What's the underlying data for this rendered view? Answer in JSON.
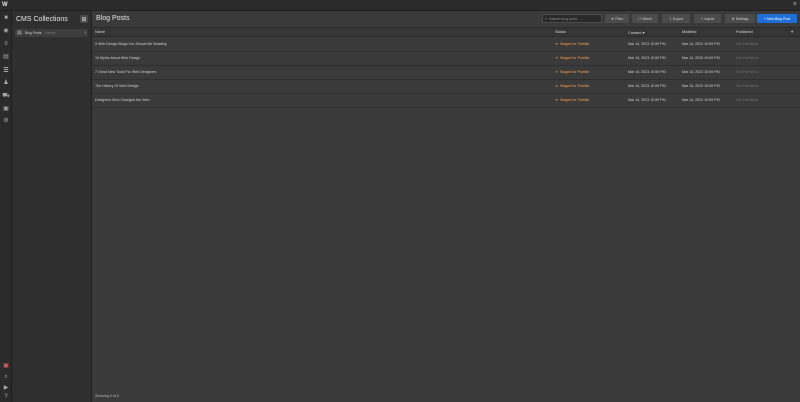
{
  "app": {
    "logo": "W",
    "close_glyph": "×"
  },
  "rail": {
    "icons": [
      "add-icon",
      "pages-icon",
      "navigator-icon",
      "file-icon",
      "cms-icon",
      "users-icon",
      "ecommerce-icon",
      "assets-icon",
      "settings-icon"
    ],
    "bottom_icons": [
      "record-icon",
      "search-icon",
      "video-icon",
      "help-icon"
    ]
  },
  "collections": {
    "title": "CMS Collections",
    "add_glyph": "⊞",
    "items": [
      {
        "label": "Blog Posts",
        "count": "5 items",
        "arrow": "›"
      }
    ]
  },
  "main": {
    "title": "Blog Posts",
    "search_placeholder": "Search blog posts",
    "toolbar": {
      "filter": "▼ Filter",
      "select": "☐ Select",
      "export": "⇩ Export",
      "import": "⇧ Import",
      "settings": "⚙ Settings",
      "new": "+ New Blog Post"
    },
    "columns": {
      "name": "Name",
      "status": "Status",
      "created": "Created ▾",
      "modified": "Modified",
      "published": "Published",
      "pin": "⌖"
    },
    "rows": [
      {
        "name": "5 Web Design Blogs You Should Be Reading",
        "status": "Staged for Publish",
        "created": "Mar 14, 2023 10:59 PM",
        "modified": "Mar 14, 2023 10:59 PM",
        "published": "Not Published"
      },
      {
        "name": "10 Myths About Web Design",
        "status": "Staged for Publish",
        "created": "Mar 14, 2023 10:59 PM",
        "modified": "Mar 14, 2023 10:59 PM",
        "published": "Not Published"
      },
      {
        "name": "7 Great New Tools For Web Designers",
        "status": "Staged for Publish",
        "created": "Mar 14, 2023 10:59 PM",
        "modified": "Mar 14, 2023 10:59 PM",
        "published": "Not Published"
      },
      {
        "name": "The History Of Web Design",
        "status": "Staged for Publish",
        "created": "Mar 14, 2023 10:59 PM",
        "modified": "Mar 14, 2023 10:59 PM",
        "published": "Not Published"
      },
      {
        "name": "Designers Who Changed the Web",
        "status": "Staged for Publish",
        "created": "Mar 14, 2023 10:59 PM",
        "modified": "Mar 14, 2023 10:59 PM",
        "published": "Not Published"
      }
    ],
    "footer": "Showing 5 of 5"
  },
  "colors": {
    "accent": "#1f6fd6",
    "status": "#f0a45a"
  }
}
